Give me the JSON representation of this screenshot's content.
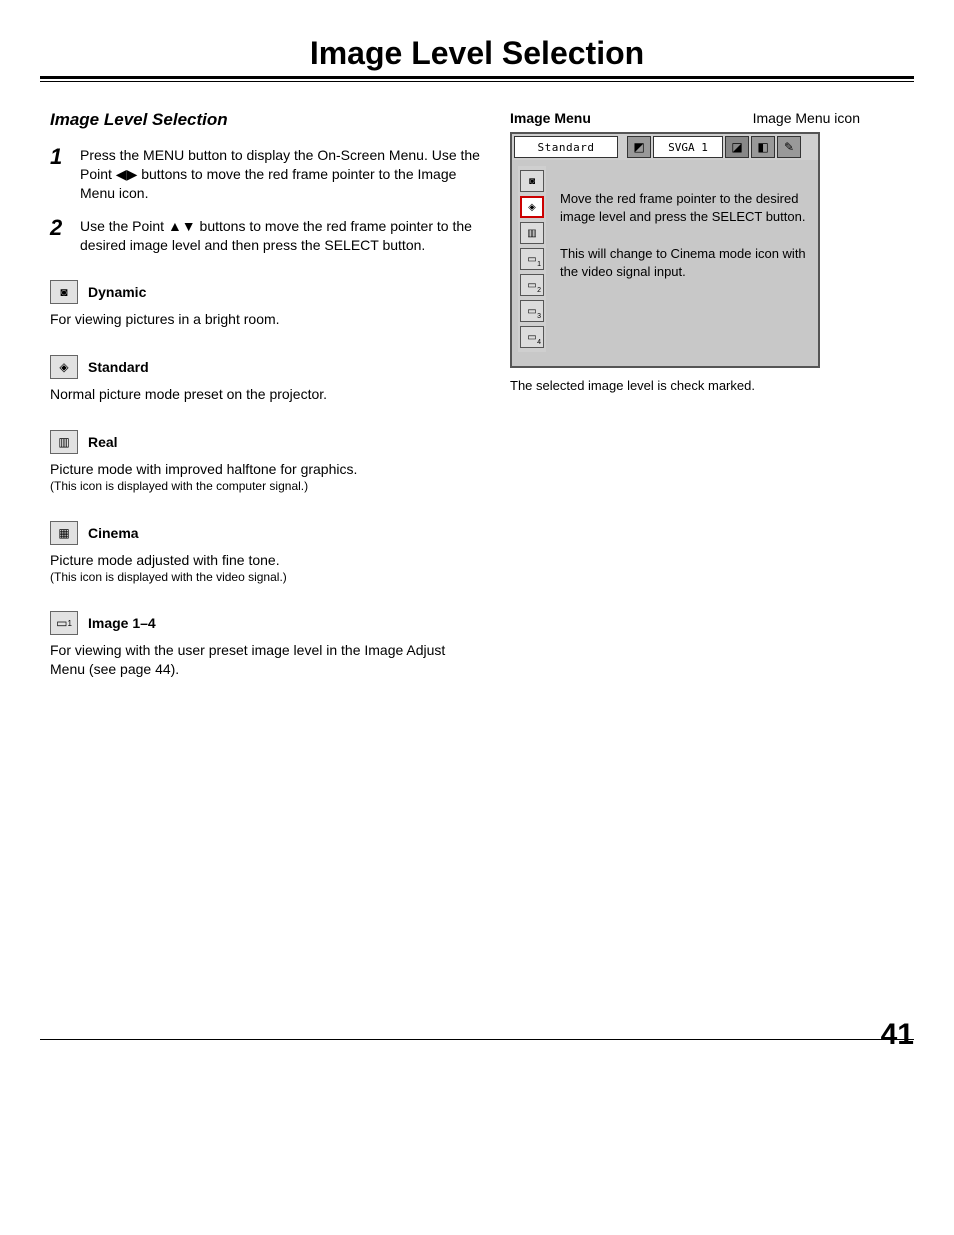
{
  "page": {
    "title": "Image Level Selection",
    "section_heading": "Image Level Selection",
    "number": "41"
  },
  "steps": {
    "s1": {
      "num": "1",
      "text": "Press the MENU button to display the On-Screen Menu. Use the Point ◀▶ buttons to move the red frame pointer to the Image Menu icon."
    },
    "s2": {
      "num": "2",
      "text": "Use the Point ▲▼ buttons to move the red frame pointer to the desired image level and then press the SELECT button."
    }
  },
  "modes": {
    "dynamic": {
      "name": "Dynamic",
      "desc": "For viewing pictures in a bright room."
    },
    "standard": {
      "name": "Standard",
      "desc": "Normal picture mode preset on the projector."
    },
    "real": {
      "name": "Real",
      "desc": "Picture mode with improved halftone for graphics.",
      "note": "(This icon is displayed with the computer signal.)"
    },
    "cinema": {
      "name": "Cinema",
      "desc": "Picture mode adjusted with fine tone.",
      "note": "(This icon is displayed with the video signal.)"
    },
    "image1_4": {
      "name": "Image 1–4",
      "desc": "For viewing with the user preset image level in the Image Adjust Menu (see page 44)."
    }
  },
  "right": {
    "panel_label": "Image Menu",
    "icon_label": "Image Menu icon",
    "menu_name": "Standard",
    "resolution": "SVGA 1",
    "callout1": "Move the red frame pointer to the desired image level and press the SELECT button.",
    "callout2": "This will change to Cinema mode icon with the video signal input.",
    "footnote": "The selected image level is check marked."
  },
  "iconGlyphs": {
    "dynamic": "◙",
    "standard": "◈",
    "real": "▥",
    "cinema": "▦",
    "image": "▭"
  }
}
